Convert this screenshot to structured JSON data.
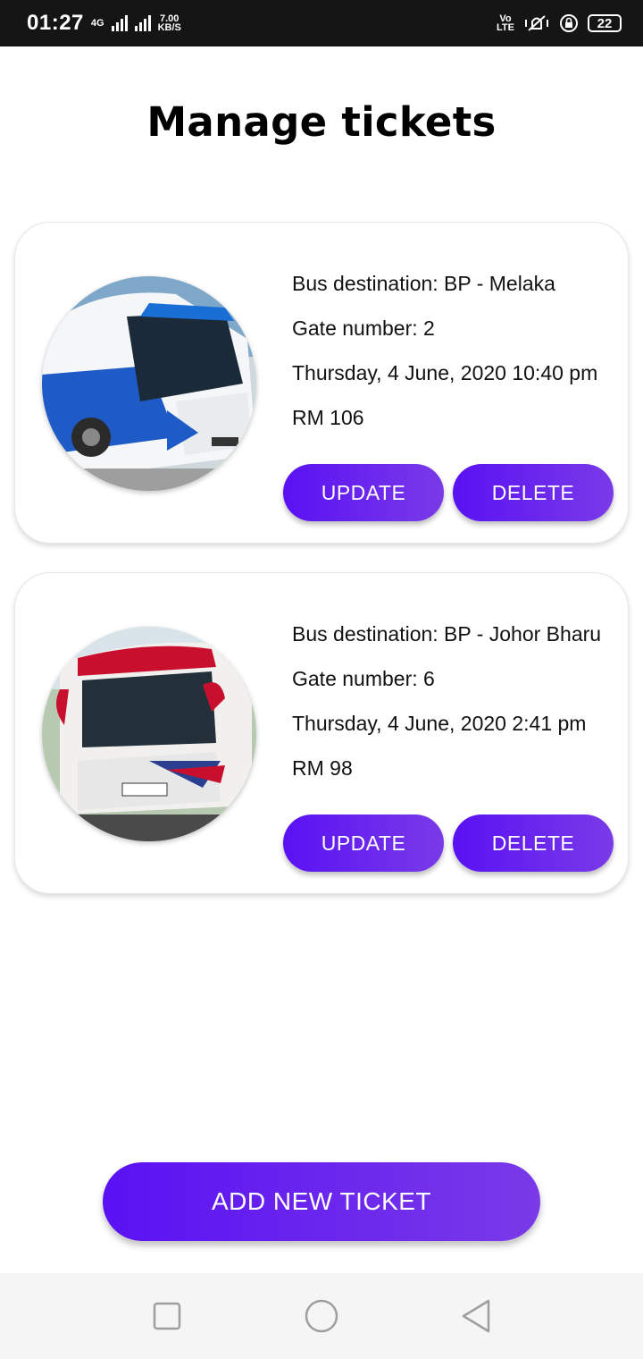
{
  "status_bar": {
    "time": "01:27",
    "network_type": "4G",
    "data_speed_value": "7.00",
    "data_speed_unit": "KB/S",
    "volte_line1": "Vo",
    "volte_line2": "LTE",
    "battery_level": "22"
  },
  "page": {
    "title": "Manage tickets"
  },
  "tickets": [
    {
      "destination": "Bus destination: BP - Melaka",
      "gate": "Gate number: 2",
      "datetime": "Thursday, 4 June, 2020 10:40 pm",
      "price": "RM 106",
      "update_label": "UPDATE",
      "delete_label": "DELETE",
      "image_name": "bus-photo-blue"
    },
    {
      "destination": "Bus destination: BP - Johor Bharu",
      "gate": "Gate number: 6",
      "datetime": "Thursday, 4 June, 2020 2:41 pm",
      "price": "RM 98",
      "update_label": "UPDATE",
      "delete_label": "DELETE",
      "image_name": "bus-photo-red"
    }
  ],
  "actions": {
    "add_new_ticket_label": "ADD NEW TICKET"
  },
  "theme": {
    "accent_start": "#5a11f3",
    "accent_end": "#7a3ae8",
    "status_bar_bg": "#151515",
    "nav_bar_bg": "#f5f5f5"
  },
  "nav_bar": {
    "icons": [
      "recent-apps-icon",
      "home-icon",
      "back-icon"
    ]
  }
}
